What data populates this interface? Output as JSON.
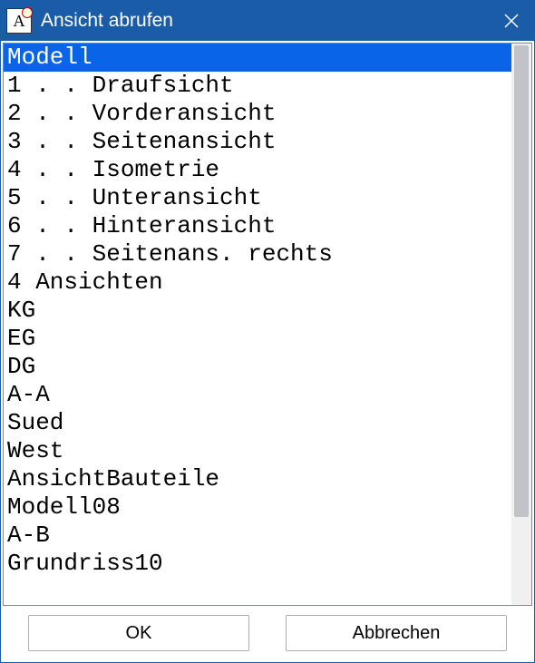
{
  "titlebar": {
    "icon_letter": "A",
    "title": "Ansicht abrufen"
  },
  "list": {
    "items": [
      {
        "label": "Modell",
        "selected": true
      },
      {
        "label": "1 . . Draufsicht",
        "selected": false
      },
      {
        "label": "2 . . Vorderansicht",
        "selected": false
      },
      {
        "label": "3 . . Seitenansicht",
        "selected": false
      },
      {
        "label": "4 . . Isometrie",
        "selected": false
      },
      {
        "label": "5 . . Unteransicht",
        "selected": false
      },
      {
        "label": "6 . . Hinteransicht",
        "selected": false
      },
      {
        "label": "7 . . Seitenans. rechts",
        "selected": false
      },
      {
        "label": "4 Ansichten",
        "selected": false
      },
      {
        "label": "KG",
        "selected": false
      },
      {
        "label": "EG",
        "selected": false
      },
      {
        "label": "DG",
        "selected": false
      },
      {
        "label": "A-A",
        "selected": false
      },
      {
        "label": "Sued",
        "selected": false
      },
      {
        "label": "West",
        "selected": false
      },
      {
        "label": "AnsichtBauteile",
        "selected": false
      },
      {
        "label": "Modell08",
        "selected": false
      },
      {
        "label": "A-B",
        "selected": false
      },
      {
        "label": "Grundriss10",
        "selected": false
      }
    ]
  },
  "buttons": {
    "ok": "OK",
    "cancel": "Abbrechen"
  }
}
